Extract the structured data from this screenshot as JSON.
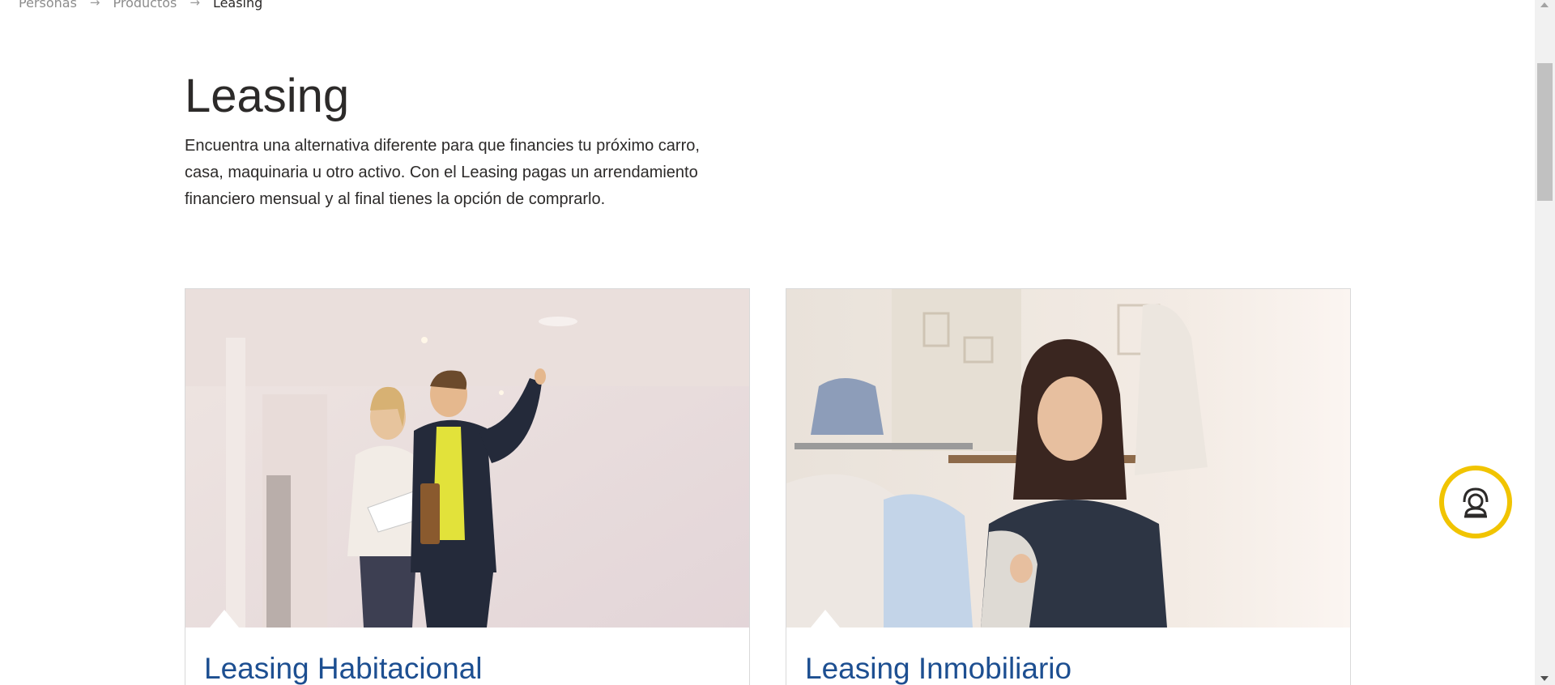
{
  "breadcrumb": {
    "items": [
      "Personas",
      "Productos"
    ],
    "current": "Leasing",
    "separator_icon": "arrow-right-icon"
  },
  "header": {
    "title": "Leasing",
    "intro": "Encuentra una alternativa diferente para que financies tu próximo carro, casa, maquinaria u otro activo. Con el Leasing pagas un arrendamiento financiero mensual y al final tienes la opción de comprarlo."
  },
  "cards": [
    {
      "title": "Leasing Habitacional",
      "image": "couple-real-estate-photo"
    },
    {
      "title": "Leasing Inmobiliario",
      "image": "shop-owner-photo"
    }
  ],
  "chat_widget": {
    "icon": "agent-headset-icon",
    "border_color": "#f1c400"
  },
  "colors": {
    "link": "#1d4f91",
    "text": "#2c2a29",
    "accent": "#f1c400"
  }
}
